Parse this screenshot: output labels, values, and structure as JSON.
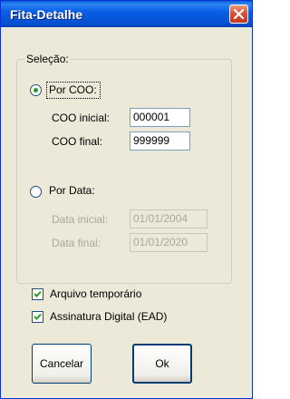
{
  "window": {
    "title": "Fita-Detalhe"
  },
  "selection": {
    "legend": "Seleção:",
    "by_coo": {
      "label": "Por COO:",
      "selected": true,
      "coo_initial_label": "COO inicial:",
      "coo_initial_value": "000001",
      "coo_final_label": "COO final:",
      "coo_final_value": "999999"
    },
    "by_date": {
      "label": "Por Data:",
      "selected": false,
      "date_initial_label": "Data inicial:",
      "date_initial_value": "01/01/2004",
      "date_final_label": "Data final:",
      "date_final_value": "01/01/2020"
    }
  },
  "options": {
    "temp_file_label": "Arquivo temporário",
    "temp_file_checked": true,
    "digital_signature_label": "Assinatura Digital (EAD)",
    "digital_signature_checked": true
  },
  "buttons": {
    "cancel_label": "Cancelar",
    "ok_label": "Ok"
  },
  "icons": {
    "close": "close-icon",
    "check": "checkmark-icon",
    "radio": "radio-dot-icon"
  },
  "colors": {
    "titlebar": "#0a5fd6",
    "window_bg": "#ece9d8",
    "close_button": "#d9533a",
    "radio_dot": "#21a121"
  }
}
